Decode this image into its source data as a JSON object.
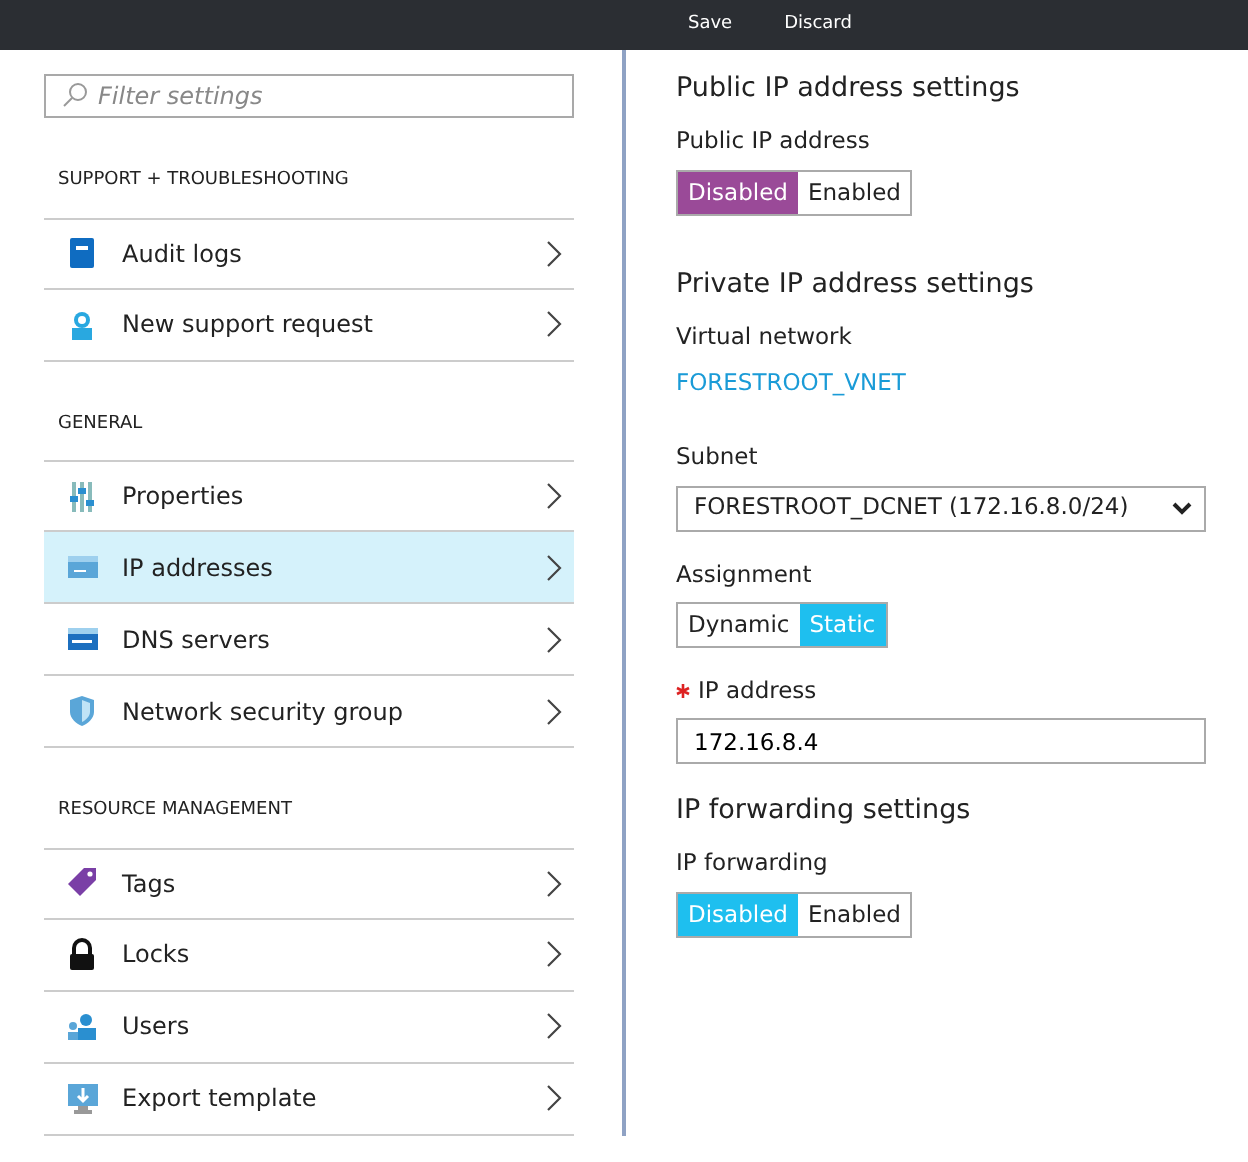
{
  "toolbar": {
    "buttons": [
      "Save",
      "Discard"
    ]
  },
  "sidebar": {
    "search": {
      "placeholder": "Filter settings"
    },
    "sections": [
      {
        "title": "SUPPORT + TROUBLESHOOTING",
        "items": [
          {
            "label": "Audit logs",
            "kind": "book",
            "selected": false
          },
          {
            "label": "New support request",
            "kind": "support",
            "selected": false
          }
        ]
      },
      {
        "title": "GENERAL",
        "items": [
          {
            "label": "Properties",
            "kind": "sliders",
            "selected": false
          },
          {
            "label": "IP addresses",
            "kind": "ip",
            "selected": true
          },
          {
            "label": "DNS servers",
            "kind": "dns",
            "selected": false
          },
          {
            "label": "Network security group",
            "kind": "shield",
            "selected": false
          }
        ]
      },
      {
        "title": "RESOURCE MANAGEMENT",
        "items": [
          {
            "label": "Tags",
            "kind": "tag",
            "selected": false
          },
          {
            "label": "Locks",
            "kind": "lock",
            "selected": false
          },
          {
            "label": "Users",
            "kind": "users",
            "selected": false
          },
          {
            "label": "Export template",
            "kind": "export",
            "selected": false
          }
        ]
      }
    ]
  },
  "form": [
    {
      "kind": "heading",
      "text": "Public IP address settings"
    },
    {
      "kind": "toggle",
      "label": "Public IP address",
      "color": "#9a4a98",
      "options": [
        {
          "label": "Disabled",
          "selected": true
        },
        {
          "label": "Enabled",
          "selected": false
        }
      ]
    },
    {
      "kind": "heading",
      "text": "Private IP address settings",
      "gap": true
    },
    {
      "kind": "link",
      "label": "Virtual network",
      "value": "FORESTROOT_VNET"
    },
    {
      "kind": "select",
      "label": "Subnet",
      "value": "FORESTROOT_DCNET (172.16.8.0/24)"
    },
    {
      "kind": "toggle",
      "label": "Assignment",
      "color": "#1ebfef",
      "options": [
        {
          "label": "Dynamic",
          "selected": false
        },
        {
          "label": "Static",
          "selected": true
        }
      ]
    },
    {
      "kind": "input",
      "label": "IP address",
      "required": true,
      "value": "172.16.8.4"
    },
    {
      "kind": "heading",
      "text": "IP forwarding settings"
    },
    {
      "kind": "toggle",
      "label": "IP forwarding",
      "color": "#1ebfef",
      "options": [
        {
          "label": "Disabled",
          "selected": true
        },
        {
          "label": "Enabled",
          "selected": false
        }
      ]
    }
  ]
}
